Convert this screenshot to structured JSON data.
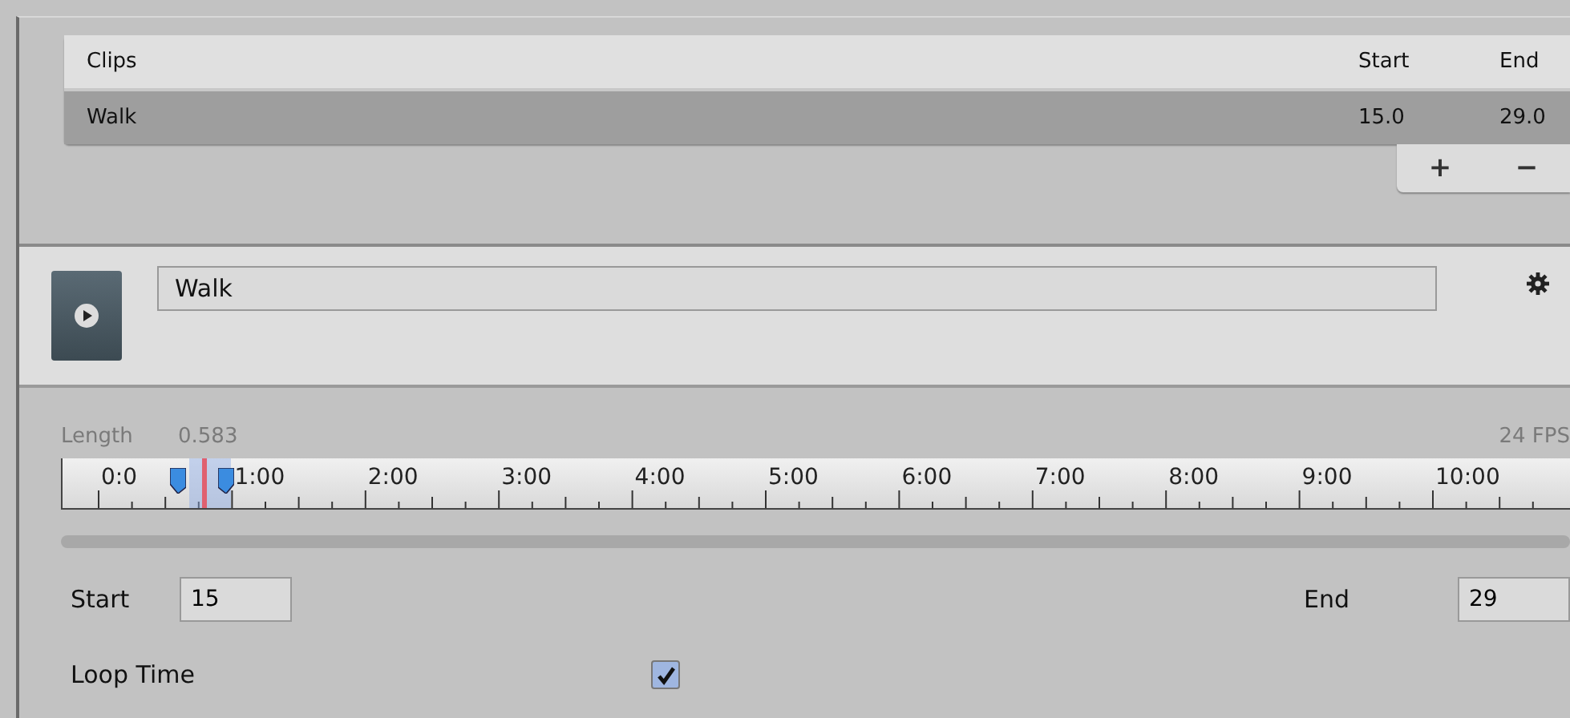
{
  "clips_table": {
    "columns": [
      "Clips",
      "Start",
      "End"
    ],
    "rows": [
      {
        "name": "Walk",
        "start": "15.0",
        "end": "29.0",
        "selected": true
      }
    ],
    "buttons": [
      "+",
      "−"
    ]
  },
  "clip_header": {
    "name": "Walk"
  },
  "timeline": {
    "length_label": "Length",
    "length": "0.583",
    "fps": "24 FPS",
    "ticks": [
      "0:0",
      "1:00",
      "2:00",
      "3:00",
      "4:00",
      "5:00",
      "6:00",
      "7:00",
      "8:00",
      "9:00",
      "10:00"
    ]
  },
  "range": {
    "start_label": "Start",
    "start": "15",
    "end_label": "End",
    "end": "29"
  },
  "options": [
    {
      "label": "Loop Time",
      "checked": true
    }
  ]
}
